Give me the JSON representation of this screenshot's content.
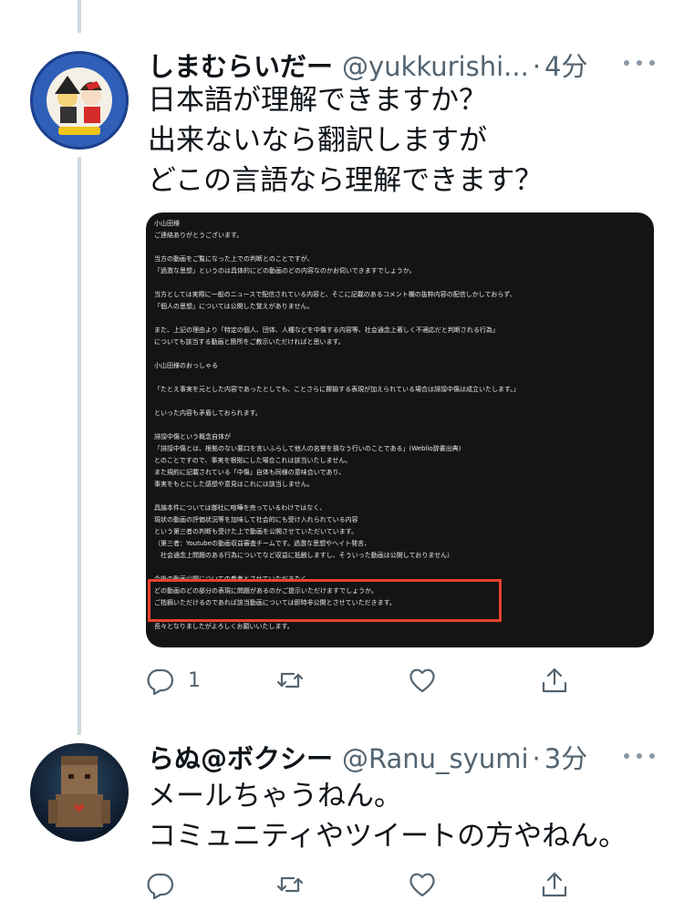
{
  "tweets": [
    {
      "display_name": "しまむらいだー",
      "handle": "@yukkurishi...",
      "separator": "·",
      "time": "4分",
      "avatar_icon": "anime-avatar-icon",
      "text_lines": [
        "日本語が理解できますか？",
        "出来ないなら翻訳しますが",
        "どこの言語なら理解できます？"
      ],
      "reply_count": "1"
    },
    {
      "display_name": "らぬ@ボクシー",
      "handle": "@Ranu_syumi",
      "separator": "·",
      "time": "3分",
      "avatar_icon": "blocky-character-avatar-icon",
      "text_lines": [
        "メールちゃうねん。",
        "コミュニティやツイートの方やねん。"
      ],
      "reply_count": ""
    }
  ],
  "media_text": [
    "小山田様",
    "ご連絡ありがとうございます。",
    "",
    "当方の動画をご覧になった上での判断とのことですが、",
    "「過激な思想」というのは具体的にどの動画のどの内容なのかお伺いできますでしょうか。",
    "",
    "当方としては実際に一般のニュースで配信されている内容と、そこに記載のあるコメント欄の抜粋内容の配信しかしておらず、",
    "「個人の思想」については公開した覚えがありません。",
    "",
    "また、上記の理由より「特定の個人、団体、人種などを中傷する内容等、社会通念上著しく不適応だと判断される行為」",
    "についても該当する動画と箇所をご教示いただければと思います。",
    "",
    "小山田様のおっしゃる",
    "",
    "「たとえ事実を元とした内容であったとしても、ことさらに揶揄する表現が加えられている場合は誹謗中傷は成立いたします。」",
    "",
    "といった内容も矛盾しておられます。",
    "",
    "誹謗中傷という概念自体が",
    "「誹謗中傷とは、根拠のない悪口を言いふらして他人の名誉を損なう行いのことである」(Weblio辞書出典)",
    "とのことですので、事実を根拠にした場合これは該当いたしません。",
    "また規約に記載されている「中傷」自体も同様の意味合いであり、",
    "事実をもとにした感想や意見はこれには該当しません。",
    "",
    "具論本件については御社に喧嘩を売っているわけではなく、",
    "現状の動画の評価状況等を加味して社会的にも受け入れられている内容",
    "という第三者の判断も受けた上で動画を公開させていただいています。",
    "（第三者：Youtubeの動画収益審査チームです。過激な思想やヘイト発言、",
    "　社会通念上問題のある行為についてなど収益に抵触しますし、そういった動画は公開しておりません）",
    "",
    "今後の動画公開についての参考とさせていただきたく、",
    "どの動画のどの部分の表現に問題があるのかご提示いただけますでしょうか。",
    "ご指摘いただけるのであれば該当動画については即時非公開とさせていただきます。",
    "",
    "長々となりましたがよろしくお願いいたします。"
  ],
  "icons": {
    "reply": "reply-icon",
    "retweet": "retweet-icon",
    "like": "like-icon",
    "share": "share-icon",
    "more": "more-icon"
  },
  "colors": {
    "highlight": "#e8412c",
    "thread_line": "#cfd9de",
    "secondary_text": "#536471"
  }
}
